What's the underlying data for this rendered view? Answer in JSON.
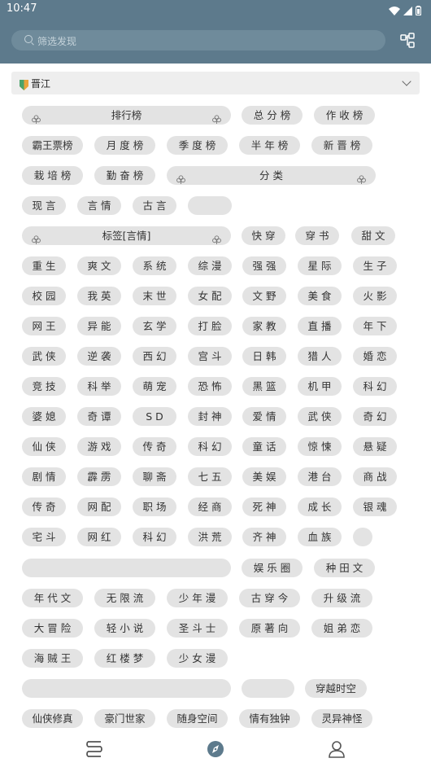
{
  "status": {
    "time": "10:47"
  },
  "search": {
    "placeholder": "筛选发现"
  },
  "source": {
    "label": "晋江"
  },
  "groups": [
    {
      "labels": [
        "排行榜",
        "总 分 榜",
        "作 收 榜",
        "霸王票榜",
        "月 度 榜",
        "季 度 榜",
        "半 年 榜",
        "新 晋 榜",
        "栽 培 榜",
        "勤 奋 榜",
        "分    类",
        "现 言",
        "言 情",
        "古 言",
        ""
      ]
    },
    {
      "labels": [
        "标签[言情]",
        "快 穿",
        "穿 书",
        "甜 文",
        "重 生",
        "爽 文",
        "系 统",
        "综 漫",
        "强 强",
        "星 际",
        "生 子",
        "校 园",
        "我 英",
        "末 世",
        "女 配",
        "文 野",
        "美 食",
        "火 影",
        "网 王",
        "异 能",
        "玄 学",
        "打 脸",
        "家 教",
        "直 播",
        "年 下",
        "武 侠",
        "逆 袭",
        "西 幻",
        "宫 斗",
        "日 韩",
        "猎 人",
        "婚 恋",
        "竞 技",
        "科 举",
        "萌 宠",
        "恐 怖",
        "黑 篮",
        "机 甲",
        "科 幻",
        "婆 媳",
        "奇 谭",
        "S D",
        "封 神",
        "爱 情",
        "武 侠",
        "奇 幻",
        "仙 侠",
        "游 戏",
        "传 奇",
        "科 幻",
        "童 话",
        "惊 悚",
        "悬 疑",
        "剧 情",
        "霹 雳",
        "聊 斋",
        "七 五",
        "美 娱",
        "港 台",
        "商 战",
        "传 奇",
        "网 配",
        "职 场",
        "经 商",
        "死 神",
        "成 长",
        "银 魂",
        "宅 斗",
        "网 红",
        "科 幻",
        "洪 荒",
        "齐 神",
        "血 族",
        ""
      ]
    },
    {
      "labels": [
        "",
        "娱 乐 圈",
        "种 田 文",
        "年 代 文",
        "无 限 流",
        "少 年 漫",
        "古 穿 今",
        "升 级 流",
        "大 冒 险",
        "轻 小 说",
        "圣 斗 士",
        "原 著 向",
        "姐 弟 恋",
        "海 贼 王",
        "红 楼 梦",
        "少 女 漫"
      ]
    },
    {
      "labels": [
        "",
        "",
        "穿越时空",
        "仙侠修真",
        "豪门世家",
        "随身空间",
        "情有独钟",
        "灵异神怪"
      ]
    }
  ],
  "colors": {
    "header": "#5d7a8c",
    "accent": "#5d7a8c",
    "chip": "#e3e3e3"
  },
  "nav": [
    "bookshelf-icon",
    "discover-icon",
    "profile-icon"
  ]
}
